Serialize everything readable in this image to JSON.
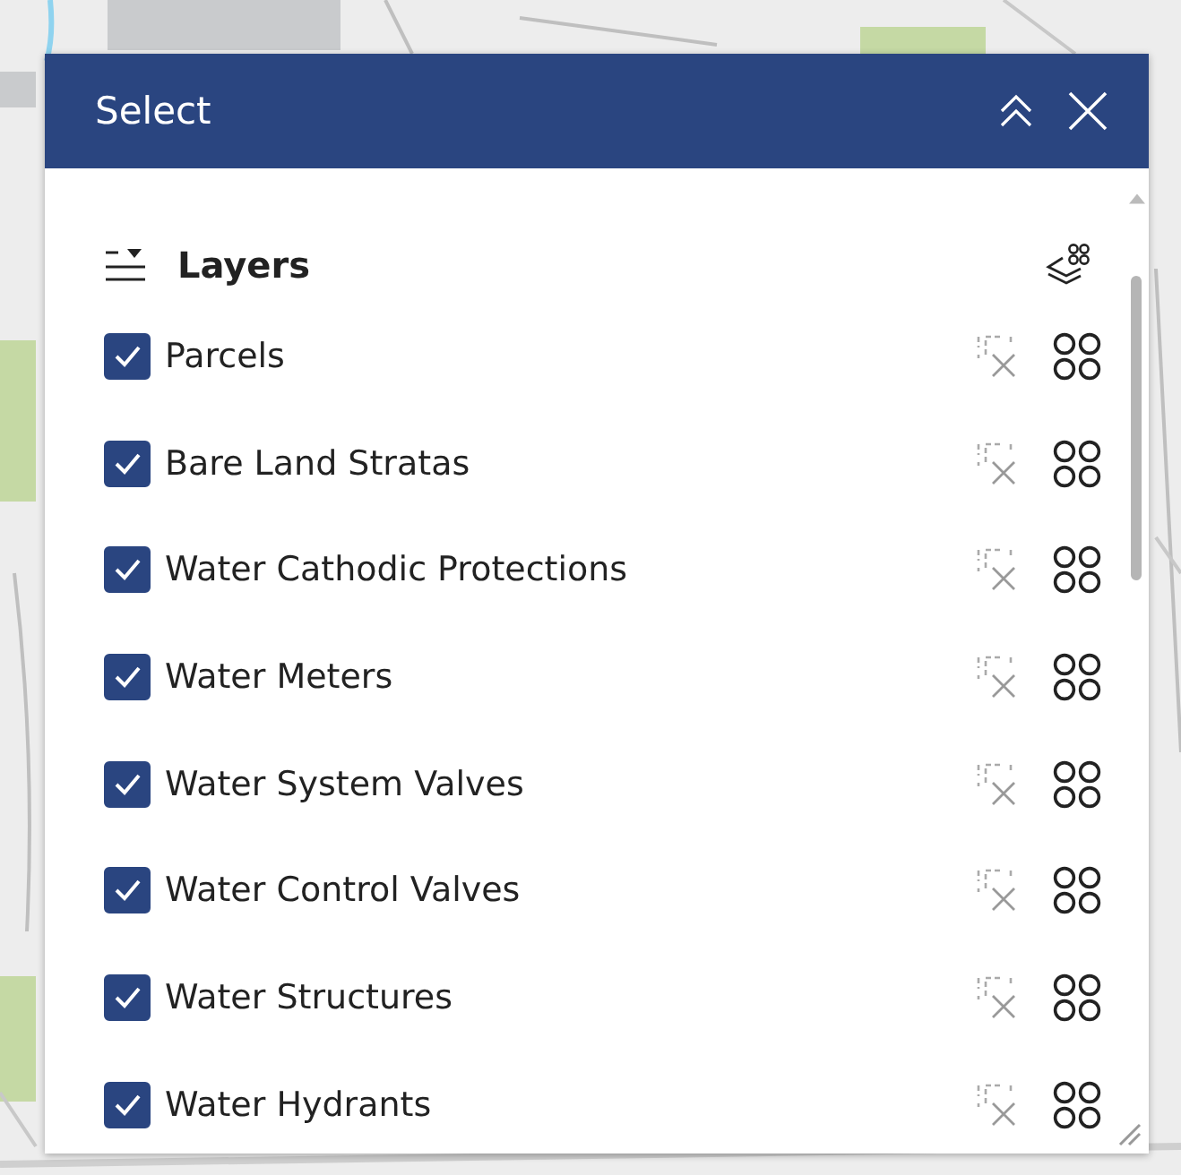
{
  "panel": {
    "title": "Select"
  },
  "section": {
    "title": "Layers"
  },
  "layers": [
    {
      "name": "Parcels",
      "checked": true
    },
    {
      "name": "Bare Land Stratas",
      "checked": true
    },
    {
      "name": "Water Cathodic Protections",
      "checked": true
    },
    {
      "name": "Water Meters",
      "checked": true
    },
    {
      "name": "Water System Valves",
      "checked": true
    },
    {
      "name": "Water Control Valves",
      "checked": true
    },
    {
      "name": "Water Structures",
      "checked": true
    },
    {
      "name": "Water Hydrants",
      "checked": true
    }
  ]
}
